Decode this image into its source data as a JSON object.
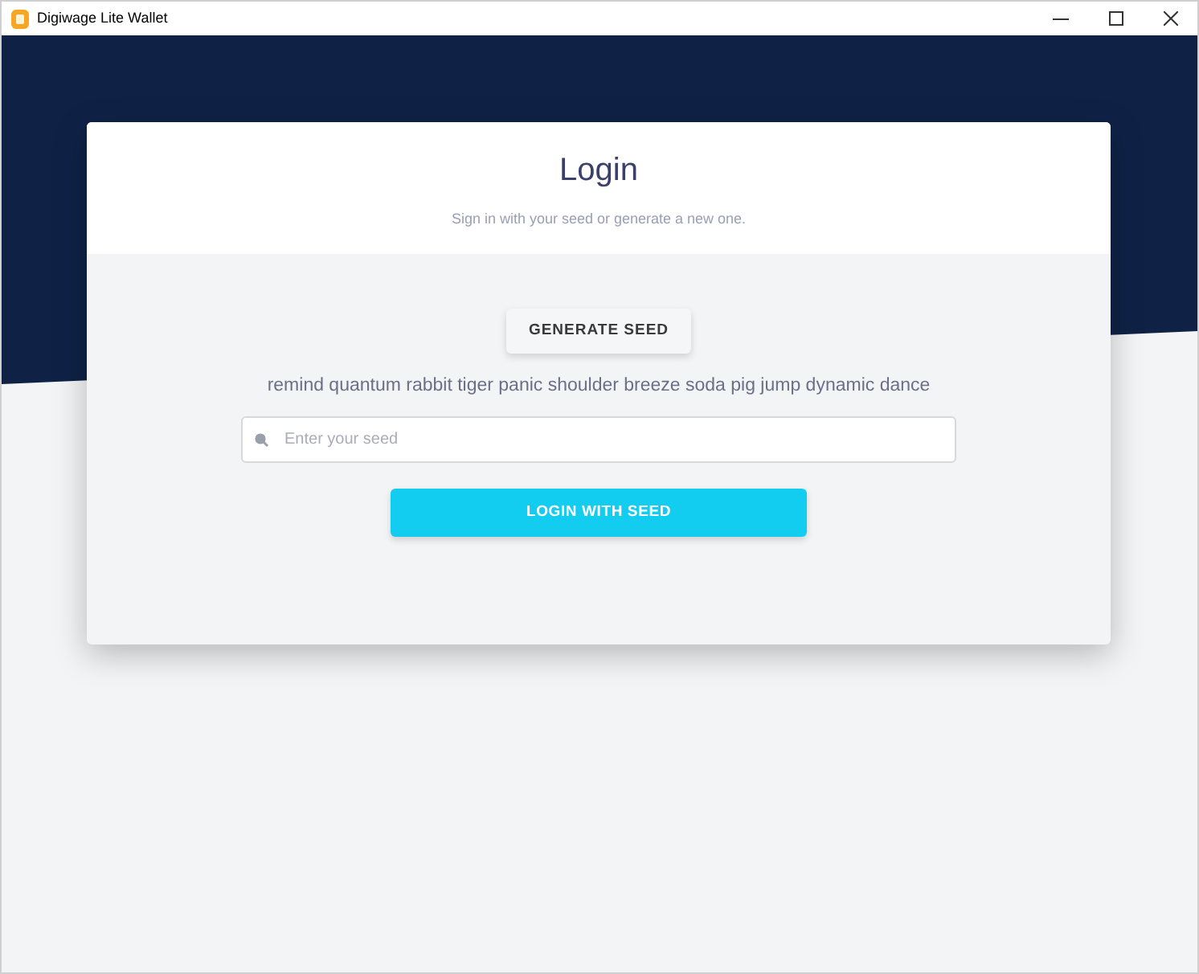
{
  "window": {
    "title": "Digiwage Lite Wallet"
  },
  "login": {
    "title": "Login",
    "subtitle": "Sign in with your seed or generate a new one.",
    "generate_button": "GENERATE SEED",
    "seed_phrase": "remind quantum rabbit tiger panic shoulder breeze soda pig jump dynamic dance",
    "seed_field": {
      "placeholder": "Enter your seed"
    },
    "login_button": "LOGIN WITH SEED"
  }
}
